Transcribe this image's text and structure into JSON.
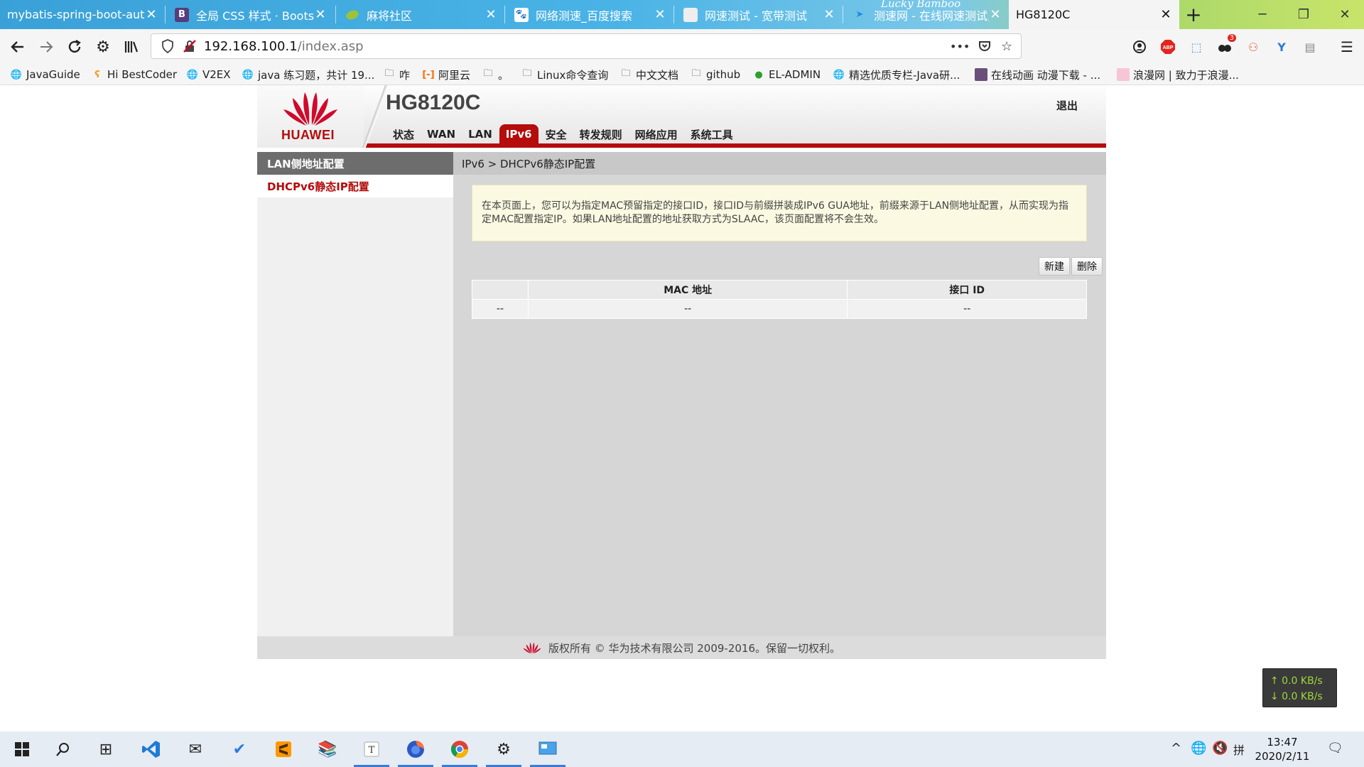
{
  "browser": {
    "tabs": [
      {
        "title": "mybatis-spring-boot-autoconfigure",
        "icon": "github-icon"
      },
      {
        "title": "全局 CSS 样式 · Bootstrap",
        "icon": "bootstrap-icon"
      },
      {
        "title": "麻将社区",
        "icon": "leaf-icon"
      },
      {
        "title": "网络测速_百度搜索",
        "icon": "baidu-icon"
      },
      {
        "title": "网速测试 - 宽带测试",
        "icon": "page-icon"
      },
      {
        "title": "测速网 - 在线网速测试,网",
        "icon": "speedtest-icon"
      },
      {
        "title": "HG8120C",
        "icon": "",
        "active": true
      }
    ],
    "new_tab_symbol": "+",
    "banner_text": "Lucky Bamboo",
    "url": {
      "host": "192.168.100.1",
      "path": "/index.asp"
    },
    "page_actions_symbol": "•••",
    "bookmarks": [
      {
        "label": "JavaGuide",
        "icon": "globe-icon"
      },
      {
        "label": "Hi BestCoder",
        "icon": "bestcoder-icon"
      },
      {
        "label": "V2EX",
        "icon": "globe-icon"
      },
      {
        "label": "java 练习题，共计 19...",
        "icon": "globe-icon"
      },
      {
        "label": "咋",
        "icon": "folder-icon"
      },
      {
        "label": "阿里云",
        "icon": "aliyun-icon"
      },
      {
        "label": "。",
        "icon": "folder-icon"
      },
      {
        "label": "Linux命令查询",
        "icon": "folder-icon"
      },
      {
        "label": "中文文档",
        "icon": "folder-icon"
      },
      {
        "label": "github",
        "icon": "folder-icon"
      },
      {
        "label": "EL-ADMIN",
        "icon": "el-admin-icon"
      },
      {
        "label": "精选优质专栏-Java研...",
        "icon": "globe-icon"
      },
      {
        "label": "在线动画 动漫下载 - ...",
        "icon": "anime-icon"
      },
      {
        "label": "浪漫网 | 致力于浪漫...",
        "icon": "langman-icon"
      }
    ],
    "extension_badge": "3"
  },
  "router": {
    "brand": "HUAWEI",
    "model": "HG8120C",
    "logout": "退出",
    "menu": [
      "状态",
      "WAN",
      "LAN",
      "IPv6",
      "安全",
      "转发规则",
      "网络应用",
      "系统工具"
    ],
    "active_menu": "IPv6",
    "sidebar": {
      "header": "LAN侧地址配置",
      "item": "DHCPv6静态IP配置"
    },
    "breadcrumb": "IPv6 > DHCPv6静态IP配置",
    "notice": "在本页面上，您可以为指定MAC预留指定的接口ID，接口ID与前缀拼装成IPv6 GUA地址，前缀来源于LAN侧地址配置，从而实现为指定MAC配置指定IP。如果LAN地址配置的地址获取方式为SLAAC，该页面配置将不会生效。",
    "buttons": {
      "new": "新建",
      "delete": "删除"
    },
    "table": {
      "headers": [
        "",
        "MAC 地址",
        "接口 ID"
      ],
      "rows": [
        [
          "--",
          "--",
          "--"
        ]
      ]
    },
    "footer": "版权所有 © 华为技术有限公司 2009-2016。保留一切权利。"
  },
  "netspeed": {
    "up": "↑ 0.0 KB/s",
    "down": "↓ 0.0 KB/s"
  },
  "taskbar": {
    "time": "13:47",
    "date": "2020/2/11"
  }
}
